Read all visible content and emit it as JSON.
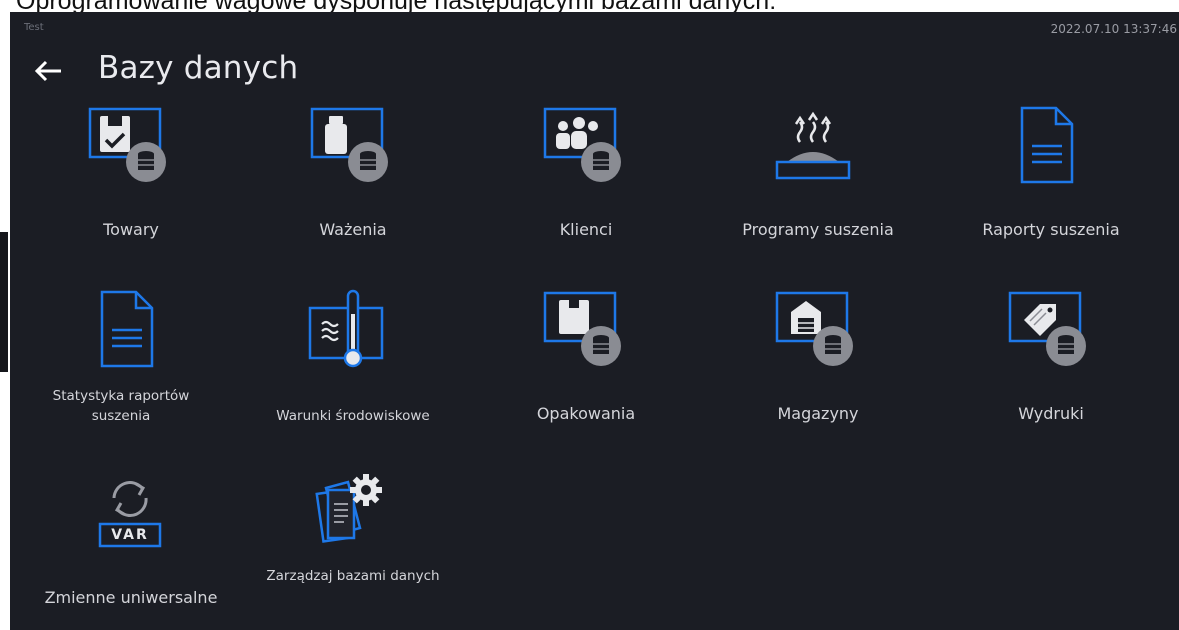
{
  "document": {
    "caption": "Oprogramowanie wagowe dysponuje następującymi bazami danych:"
  },
  "topbar": {
    "corner_text": "Test",
    "datetime": "2022.07.10 13:37:46"
  },
  "header": {
    "back_icon": "arrow-left-icon",
    "title": "Bazy danych"
  },
  "colors": {
    "background": "#1b1d24",
    "accent_blue": "#1e78e8",
    "database_grey": "#8a8c93",
    "text": "#d4d5da"
  },
  "tiles": [
    {
      "label": "Towary",
      "icon": "products-database-icon"
    },
    {
      "label": "Ważenia",
      "icon": "weighings-database-icon"
    },
    {
      "label": "Klienci",
      "icon": "customers-database-icon"
    },
    {
      "label": "Programy suszenia",
      "icon": "drying-programs-icon"
    },
    {
      "label": "Raporty suszenia",
      "icon": "drying-reports-icon"
    },
    {
      "label": "Statystyka raportów suszenia",
      "icon": "drying-report-statistics-icon"
    },
    {
      "label": "Warunki środowiskowe",
      "icon": "ambient-conditions-icon"
    },
    {
      "label": "Opakowania",
      "icon": "packaging-database-icon"
    },
    {
      "label": "Magazyny",
      "icon": "warehouses-database-icon"
    },
    {
      "label": "Wydruki",
      "icon": "printouts-database-icon"
    },
    {
      "label": "Zmienne uniwersalne",
      "icon": "universal-variables-icon",
      "badge": "VAR"
    },
    {
      "label": "Zarządzaj bazami danych",
      "icon": "manage-databases-icon"
    }
  ]
}
